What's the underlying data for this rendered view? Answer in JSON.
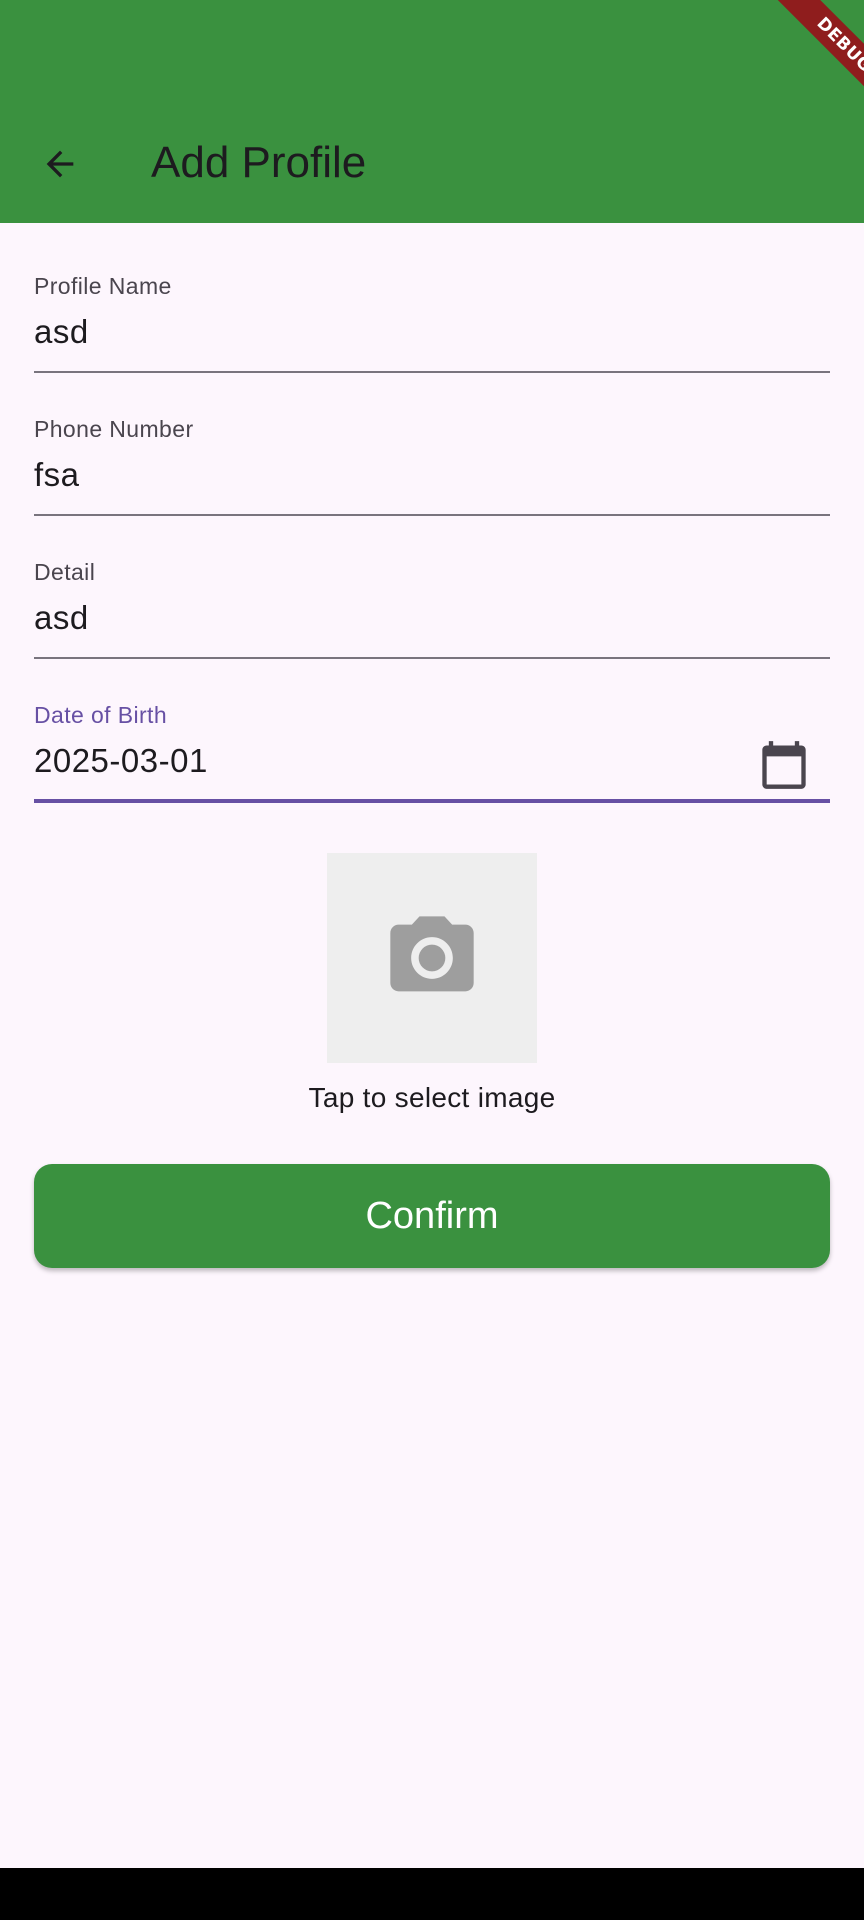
{
  "app_bar": {
    "title": "Add Profile",
    "back_icon": "arrow-back-icon",
    "color": "#3a913f"
  },
  "debug_banner": {
    "label": "DEBUG",
    "color": "#8f1d1d"
  },
  "form": {
    "profile_name": {
      "label": "Profile Name",
      "value": "asd"
    },
    "phone_number": {
      "label": "Phone Number",
      "value": "fsa"
    },
    "detail": {
      "label": "Detail",
      "value": "asd"
    },
    "date_of_birth": {
      "label": "Date of Birth",
      "value": "2025-03-01",
      "icon": "calendar-icon",
      "focused": true
    }
  },
  "image_picker": {
    "icon": "camera-icon",
    "caption": "Tap to select image"
  },
  "confirm_button": {
    "label": "Confirm",
    "color": "#3a913f"
  },
  "accent_color": "#6750a4"
}
